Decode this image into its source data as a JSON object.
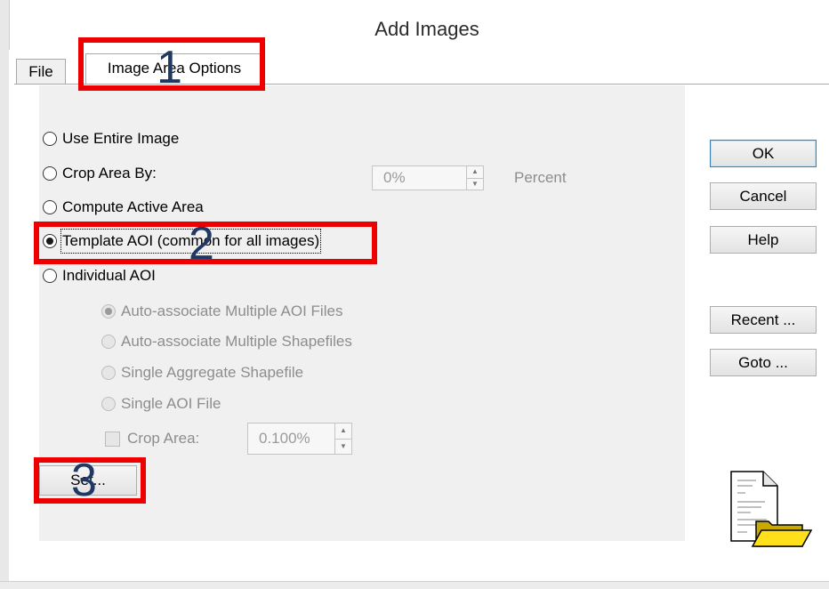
{
  "dialog": {
    "title": "Add Images"
  },
  "tabs": [
    {
      "label": "File"
    },
    {
      "label": "Image Area Options"
    }
  ],
  "options": {
    "use_entire_image": "Use Entire Image",
    "crop_area_by": "Crop Area By:",
    "crop_value": "0%",
    "crop_unit": "Percent",
    "compute_active_area": "Compute Active Area",
    "template_aoi": "Template AOI (common for all images)",
    "individual_aoi": "Individual AOI",
    "selected": "template_aoi"
  },
  "individual_aoi_options": {
    "auto_multiple_aoi": "Auto-associate Multiple AOI Files",
    "auto_multiple_shapefiles": "Auto-associate Multiple Shapefiles",
    "single_aggregate_shapefile": "Single Aggregate Shapefile",
    "single_aoi_file": "Single AOI File",
    "crop_area_label": "Crop Area:",
    "crop_area_value": "0.100%",
    "set_button": "Set..."
  },
  "buttons": {
    "ok": "OK",
    "cancel": "Cancel",
    "help": "Help",
    "recent": "Recent ...",
    "goto": "Goto ..."
  },
  "annotations": [
    "1",
    "2",
    "3"
  ],
  "colors": {
    "annotation_border": "#ee0000",
    "annotation_number": "#1f3864",
    "panel": "#f0f0f0"
  },
  "icons": {
    "dialog_icon": "document-folder-icon"
  }
}
